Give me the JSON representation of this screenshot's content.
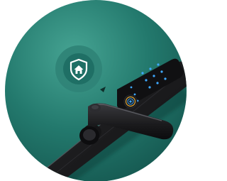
{
  "scene": {
    "subject": "smart-door-lock",
    "background_color": "#ffffff",
    "colors": {
      "circle_light": "#3f9a8a",
      "circle_mid": "#22786c",
      "circle_dark": "#175f57",
      "badge_ring": "#2f8477",
      "badge_core": "#1f6f65",
      "lock_body": "#1b1b1d",
      "lock_panel": "#121214",
      "keypad_glow": "#3fa9ff",
      "fingerprint_accent": "#e0a638"
    }
  },
  "badge": {
    "icon": "shield-home-icon"
  }
}
